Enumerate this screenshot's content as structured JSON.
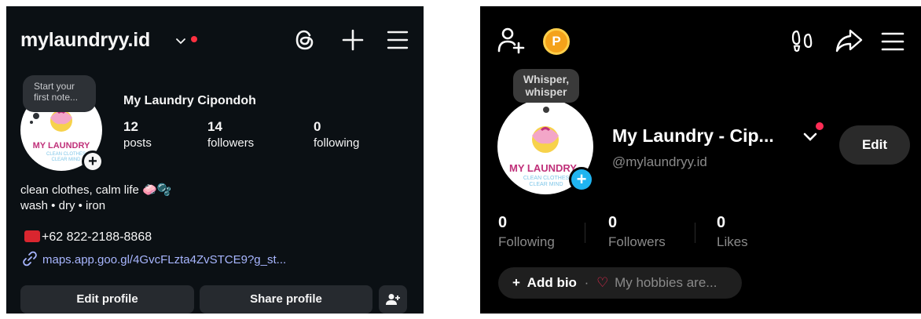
{
  "instagram": {
    "username": "mylaundryy.id",
    "note_text": "Start your first note...",
    "full_name": "My Laundry Cipondoh",
    "stats": [
      {
        "value": "12",
        "label": "posts"
      },
      {
        "value": "14",
        "label": "followers"
      },
      {
        "value": "0",
        "label": "following"
      }
    ],
    "bio_line1": "clean clothes, calm life 🧼🫧",
    "bio_line2": "wash • dry • iron",
    "phone": "+62 822-2188-8868",
    "link": "maps.app.goo.gl/4GvcFLzta4ZvSTCE9?g_st...",
    "edit_profile_label": "Edit profile",
    "share_profile_label": "Share profile",
    "logo_title": "MY LAUNDRY",
    "logo_sub1": "CLEAN CLOTHES",
    "logo_sub2": "CLEAR MIND"
  },
  "tiktok": {
    "coin_label": "P",
    "whisper_text": "Whisper, whisper",
    "display_name": "My Laundry - Cip...",
    "handle": "@mylaundryy.id",
    "edit_label": "Edit",
    "stats": [
      {
        "value": "0",
        "label": "Following"
      },
      {
        "value": "0",
        "label": "Followers"
      },
      {
        "value": "0",
        "label": "Likes"
      }
    ],
    "bio_plus": "+",
    "add_bio_label": "Add bio",
    "bio_separator": "·",
    "hobby_placeholder": "My hobbies are...",
    "logo_title": "MY LAUNDRY",
    "logo_sub1": "CLEAN CLOTHES",
    "logo_sub2": "CLEAR MIND"
  },
  "colors": {
    "instagram_bg": "#0b1014",
    "tiktok_bg": "#000000",
    "link_blue": "#a8b6ff",
    "notification_red": "#ff3040",
    "tiktok_pink": "#fe2c55",
    "tiktok_story_blue": "#20b4f0",
    "coin_orange": "#f4a21a"
  }
}
